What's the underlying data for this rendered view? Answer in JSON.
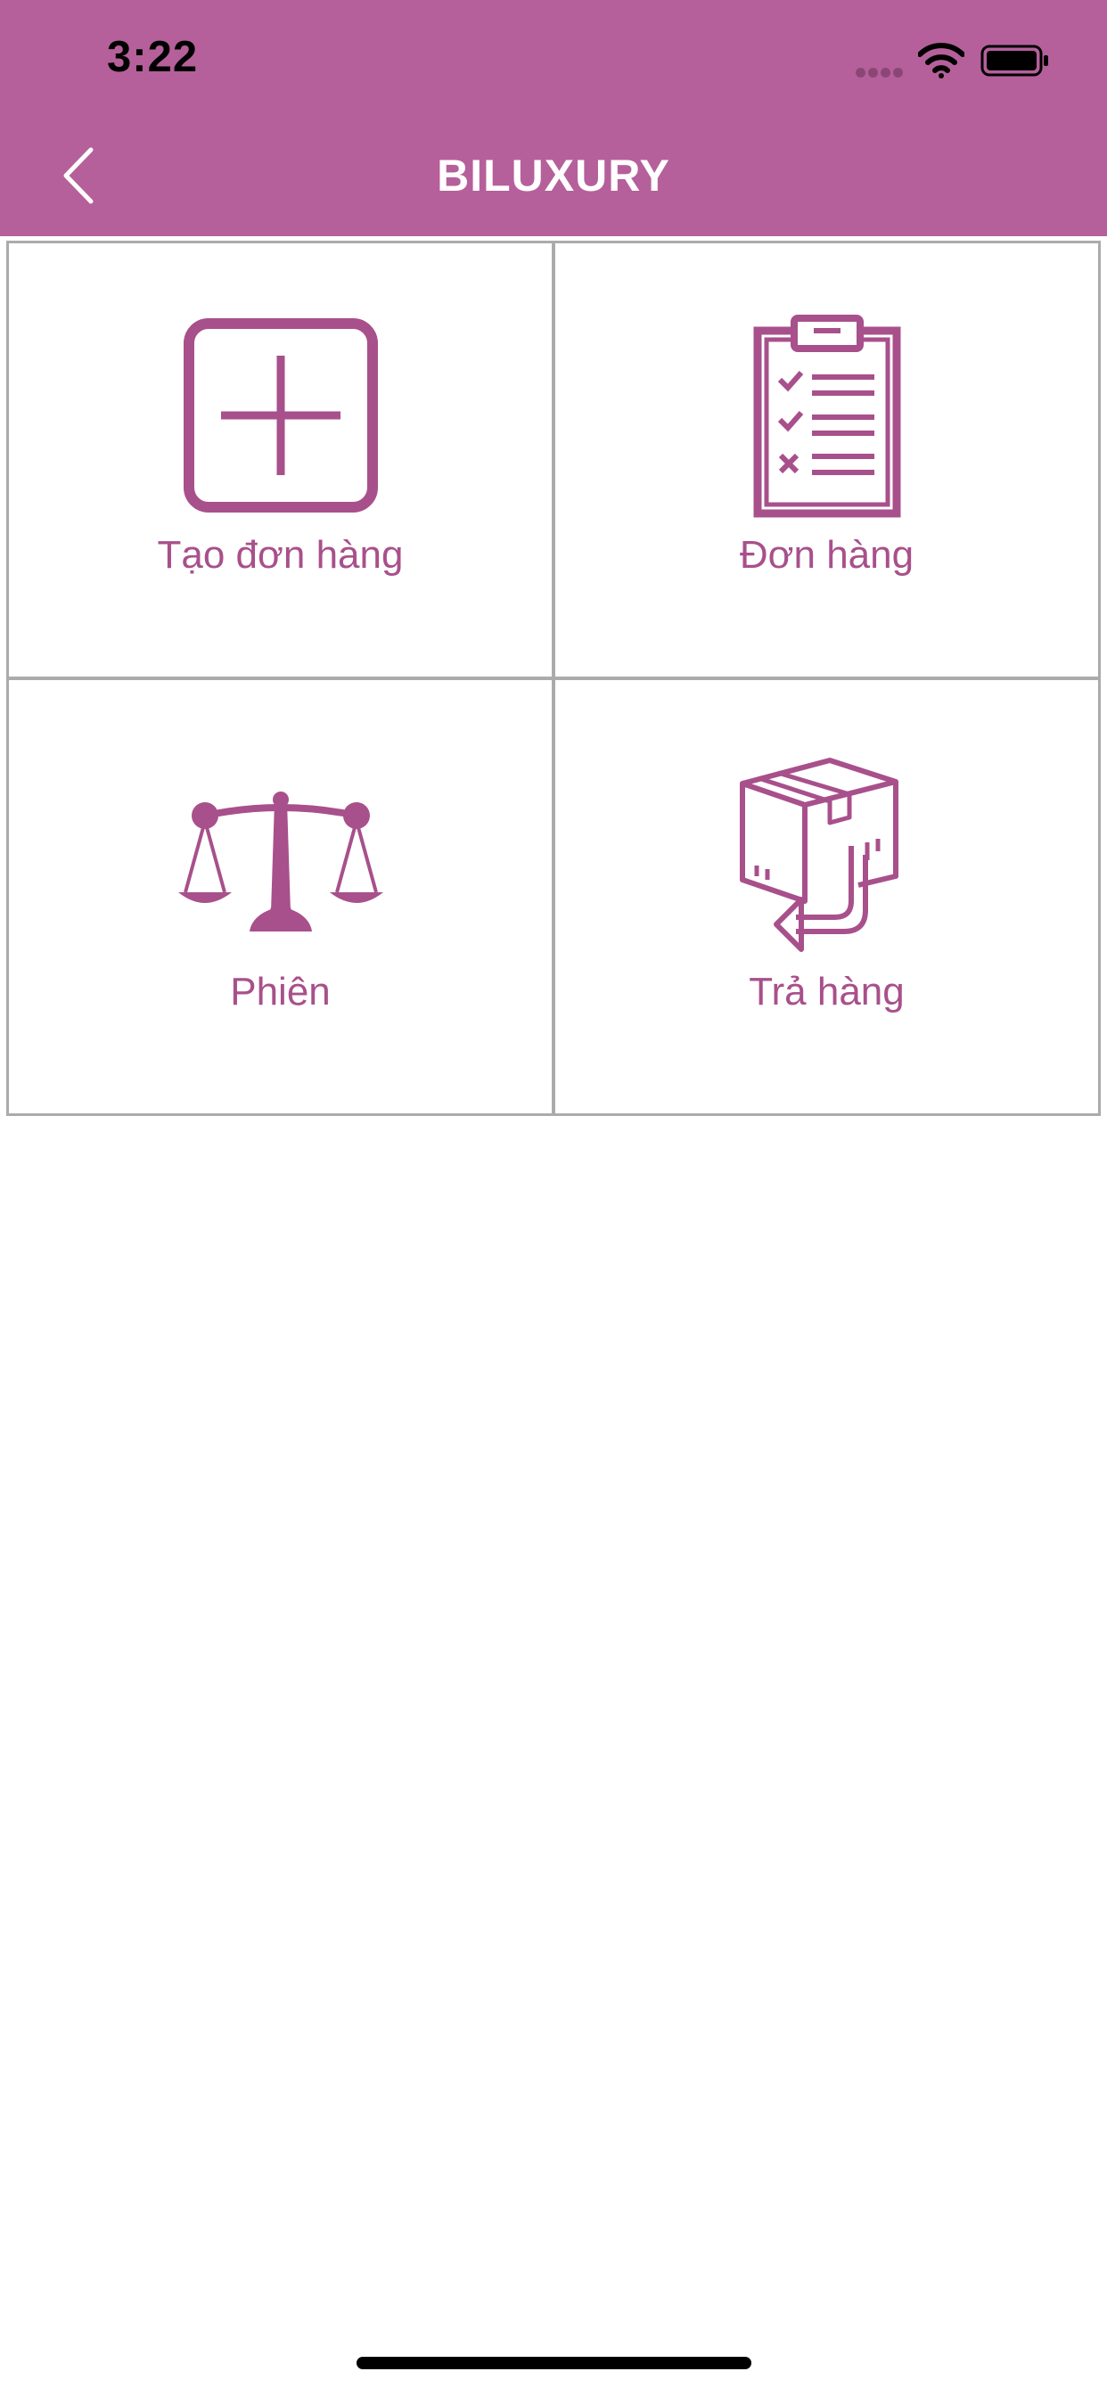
{
  "status_bar": {
    "time": "3:22"
  },
  "nav": {
    "title": "BILUXURY",
    "back_icon": "chevron-left-icon"
  },
  "tiles": [
    {
      "label": "Tạo đơn hàng",
      "icon": "plus-square-icon"
    },
    {
      "label": "Đơn hàng",
      "icon": "clipboard-checklist-icon"
    },
    {
      "label": "Phiên",
      "icon": "balance-scale-icon"
    },
    {
      "label": "Trả hàng",
      "icon": "package-return-icon"
    }
  ],
  "colors": {
    "header": "#b5609b",
    "icon": "#a8508b",
    "grid_border": "#ababab"
  }
}
